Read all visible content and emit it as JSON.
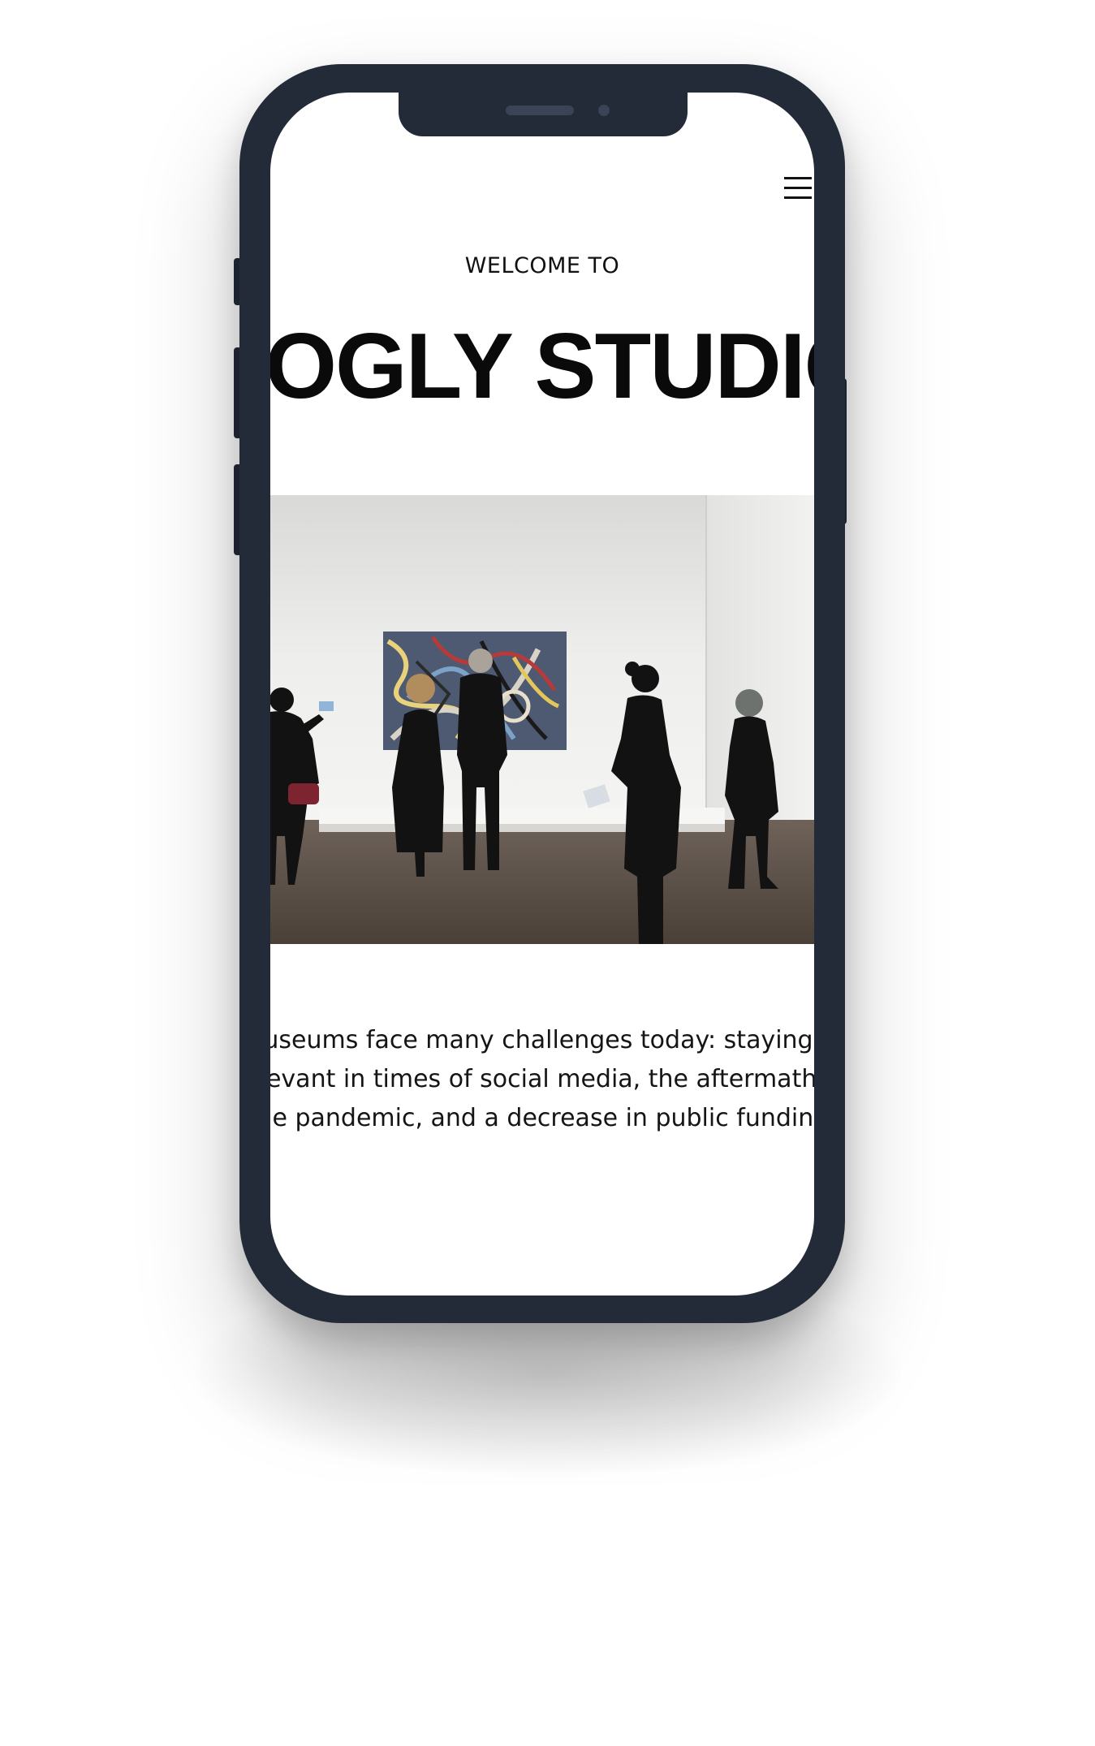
{
  "header": {
    "menu_icon": "hamburger-menu-icon"
  },
  "hero": {
    "kicker": "WELCOME TO",
    "title": "LOGLY STUDIO",
    "image_icon": "gallery-photo"
  },
  "intro": {
    "lines": [
      "useums face many challenges today: staying",
      "levant in times of social media, the aftermath",
      "the pandemic, and a decrease in public funding"
    ]
  },
  "device": {
    "frame_color": "#232a38"
  }
}
